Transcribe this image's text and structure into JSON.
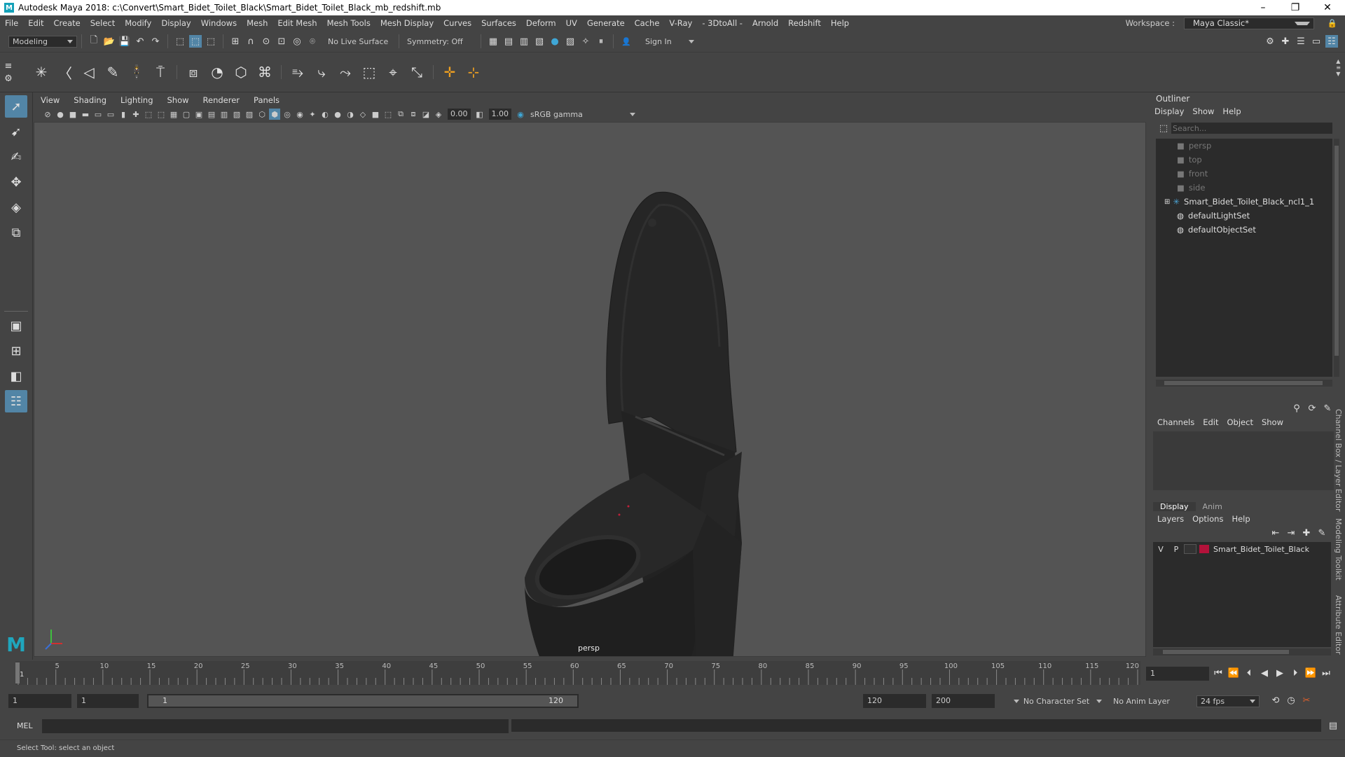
{
  "window": {
    "title": "Autodesk Maya 2018: c:\\Convert\\Smart_Bidet_Toilet_Black\\Smart_Bidet_Toilet_Black_mb_redshift.mb",
    "logo_letter": "M"
  },
  "menubar": {
    "items": [
      "File",
      "Edit",
      "Create",
      "Select",
      "Modify",
      "Display",
      "Windows",
      "Mesh",
      "Edit Mesh",
      "Mesh Tools",
      "Mesh Display",
      "Curves",
      "Surfaces",
      "Deform",
      "UV",
      "Generate",
      "Cache",
      "V-Ray",
      "- 3DtoAll -",
      "Arnold",
      "Redshift",
      "Help"
    ],
    "workspace_label": "Workspace :",
    "workspace_value": "Maya Classic*"
  },
  "statusline": {
    "mode": "Modeling",
    "live_surface": "No Live Surface",
    "symmetry": "Symmetry: Off",
    "sign_in": "Sign In"
  },
  "viewport": {
    "menu": [
      "View",
      "Shading",
      "Lighting",
      "Show",
      "Renderer",
      "Panels"
    ],
    "exposure": "0.00",
    "gamma": "1.00",
    "color_space": "sRGB gamma",
    "camera_label": "persp"
  },
  "outliner": {
    "title": "Outliner",
    "menu": [
      "Display",
      "Show",
      "Help"
    ],
    "search_placeholder": "Search...",
    "items": [
      {
        "label": "persp",
        "dim": true,
        "icon": "camera-icon"
      },
      {
        "label": "top",
        "dim": true,
        "icon": "camera-icon"
      },
      {
        "label": "front",
        "dim": true,
        "icon": "camera-icon"
      },
      {
        "label": "side",
        "dim": true,
        "icon": "camera-icon"
      },
      {
        "label": "Smart_Bidet_Toilet_Black_ncl1_1",
        "dim": false,
        "icon": "group-icon"
      },
      {
        "label": "defaultLightSet",
        "dim": false,
        "icon": "set-icon"
      },
      {
        "label": "defaultObjectSet",
        "dim": false,
        "icon": "set-icon"
      }
    ]
  },
  "channelbox": {
    "menu": [
      "Channels",
      "Edit",
      "Object",
      "Show"
    ]
  },
  "layers": {
    "tabs": [
      "Display",
      "Anim"
    ],
    "menu": [
      "Layers",
      "Options",
      "Help"
    ],
    "layer": {
      "v": "V",
      "p": "P",
      "name": "Smart_Bidet_Toilet_Black",
      "color": "#b3123a"
    }
  },
  "side_tabs": [
    "Channel Box / Layer Editor",
    "Modeling Toolkit",
    "Attribute Editor"
  ],
  "timeslider": {
    "tick_labels": [
      "5",
      "10",
      "15",
      "20",
      "25",
      "30",
      "35",
      "40",
      "45",
      "50",
      "55",
      "60",
      "65",
      "70",
      "75",
      "80",
      "85",
      "90",
      "95",
      "100",
      "105",
      "110",
      "115",
      "120"
    ],
    "first_label": "1",
    "current_frame": "1"
  },
  "range": {
    "start_anim": "1",
    "start_play": "1",
    "slider_start": "1",
    "slider_end": "120",
    "end_play": "120",
    "end_anim": "200",
    "character_set": "No Character Set",
    "anim_layer": "No Anim Layer",
    "fps": "24 fps"
  },
  "cmdline": {
    "lang": "MEL"
  },
  "helpline": {
    "text": "Select Tool: select an object"
  }
}
